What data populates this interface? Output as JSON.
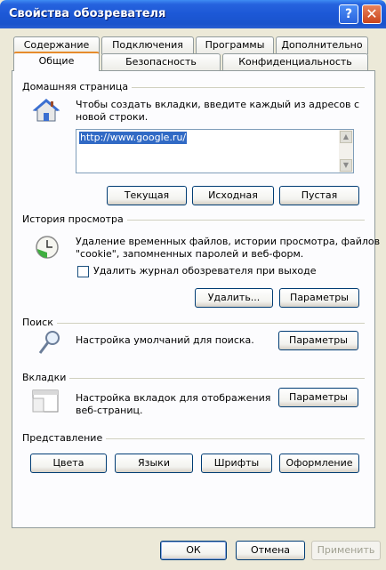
{
  "window": {
    "title": "Свойства обозревателя",
    "help_glyph": "?",
    "close_glyph": "✕"
  },
  "tabs": {
    "back": [
      "Содержание",
      "Подключения",
      "Программы",
      "Дополнительно"
    ],
    "front": [
      "Общие",
      "Безопасность",
      "Конфиденциальность"
    ]
  },
  "home": {
    "label": "Домашняя страница",
    "desc1": "Чтобы создать вкладки, введите каждый из адресов с",
    "desc2": "новой строки.",
    "url": "http://www.google.ru/",
    "current": "Текущая",
    "default": "Исходная",
    "blank": "Пустая"
  },
  "history": {
    "label": "История просмотра",
    "desc1": "Удаление временных файлов, истории просмотра, файлов",
    "desc2": "\"cookie\", запомненных паролей и веб-форм.",
    "checkbox": "Удалить журнал обозревателя при выходе",
    "delete": "Удалить...",
    "settings": "Параметры"
  },
  "search": {
    "label": "Поиск",
    "desc": "Настройка умолчаний для поиска.",
    "settings": "Параметры"
  },
  "tabs_group": {
    "label": "Вкладки",
    "desc1": "Настройка вкладок для отображения",
    "desc2": "веб-страниц.",
    "settings": "Параметры"
  },
  "appearance": {
    "label": "Представление",
    "colors": "Цвета",
    "languages": "Языки",
    "fonts": "Шрифты",
    "accessibility": "Оформление"
  },
  "footer": {
    "ok": "ОК",
    "cancel": "Отмена",
    "apply": "Применить"
  }
}
